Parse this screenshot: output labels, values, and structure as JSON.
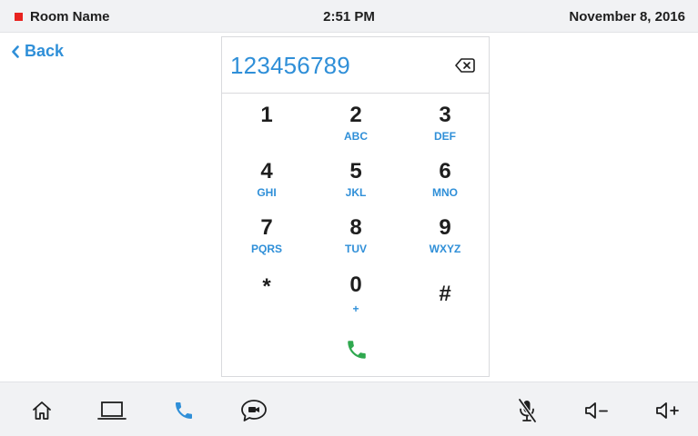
{
  "status_bar": {
    "room_name": "Room Name",
    "time": "2:51 PM",
    "date": "November 8, 2016",
    "room_indicator_color": "#e8231f"
  },
  "back": {
    "label": "Back",
    "icon": "chevron-left-icon"
  },
  "dialer": {
    "number": "123456789",
    "backspace_icon": "backspace-icon",
    "keys": [
      {
        "digit": "1",
        "letters": ""
      },
      {
        "digit": "2",
        "letters": "ABC"
      },
      {
        "digit": "3",
        "letters": "DEF"
      },
      {
        "digit": "4",
        "letters": "GHI"
      },
      {
        "digit": "5",
        "letters": "JKL"
      },
      {
        "digit": "6",
        "letters": "MNO"
      },
      {
        "digit": "7",
        "letters": "PQRS"
      },
      {
        "digit": "8",
        "letters": "TUV"
      },
      {
        "digit": "9",
        "letters": "WXYZ"
      },
      {
        "digit": "*",
        "letters": ""
      },
      {
        "digit": "0",
        "letters": "+"
      },
      {
        "digit": "#",
        "letters": ""
      }
    ],
    "call_icon": "phone-icon",
    "call_color": "#2fa84f"
  },
  "nav": {
    "items": [
      {
        "icon": "home-icon"
      },
      {
        "icon": "laptop-icon"
      },
      {
        "icon": "phone-icon",
        "active": true
      },
      {
        "icon": "video-chat-icon"
      },
      {
        "icon": "mic-muted-icon"
      },
      {
        "icon": "volume-down-icon"
      },
      {
        "icon": "volume-up-icon"
      }
    ]
  },
  "colors": {
    "accent": "#2f8fd8",
    "bar_bg": "#f1f2f4",
    "text": "#1e1e1e"
  }
}
